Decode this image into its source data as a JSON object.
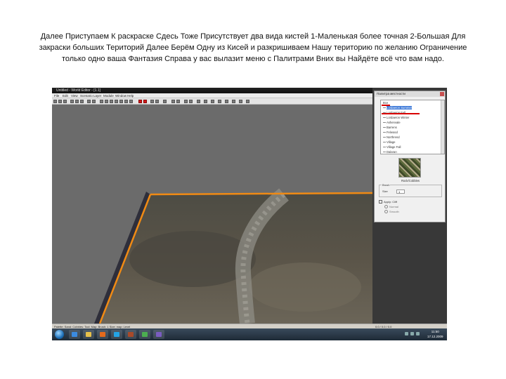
{
  "caption": {
    "line1": "Далее Приступаем К раскраске Сдесь Тоже Присутствует два вида кистей 1-Маленькая более точная 2-Большая Для",
    "line2": "закраски больших Територий Далее Берём Одну из Кисей и разкришиваем Нашу територию по желанию Ограничение",
    "line3": "только одно ваша Фантазия Справа у вас вылазит меню с Палитрами Вних вы Найдёте всё что вам надо."
  },
  "editor": {
    "title": "Untitled - World Editor - [1.1]",
    "menus": [
      "File",
      "Edit",
      "View",
      "Scenario",
      "Layer",
      "Module",
      "Window",
      "Help"
    ],
    "status": "Palette: Sand: Cobbles: Tool: Map: Brush: 1 Size: map: Level",
    "coords": "0.0 / 0.0 / 0.0"
  },
  "tile_palette": {
    "title": "Палитра местности",
    "items": [
      {
        "label": "Все",
        "state": "root"
      },
      {
        "label": "Lordaeron Summer",
        "state": "selected"
      },
      {
        "label": "Lordaeron Fall",
        "state": "normal"
      },
      {
        "label": "Lordaeron Winter",
        "state": "normal"
      },
      {
        "label": "Ashenvale",
        "state": "normal"
      },
      {
        "label": "Barrens",
        "state": "normal"
      },
      {
        "label": "Felwood",
        "state": "normal"
      },
      {
        "label": "Northrend",
        "state": "normal"
      },
      {
        "label": "Village",
        "state": "normal"
      },
      {
        "label": "Village Fall",
        "state": "normal"
      },
      {
        "label": "Dalaran",
        "state": "normal"
      }
    ],
    "preview_label": "Rock/Cobbles",
    "brush_group_title": "Brush",
    "brush_size_label": "Size",
    "brush_size": "1",
    "option_label": "Apply: Cliff",
    "radio_options": [
      "Normal",
      "Smooth"
    ]
  },
  "taskbar": {
    "clock_time": "11:50",
    "clock_date": "17.12.2009"
  },
  "colors": {
    "map_edge": "#f08a14",
    "selection": "#3b78d8",
    "annotation": "#d80000"
  }
}
